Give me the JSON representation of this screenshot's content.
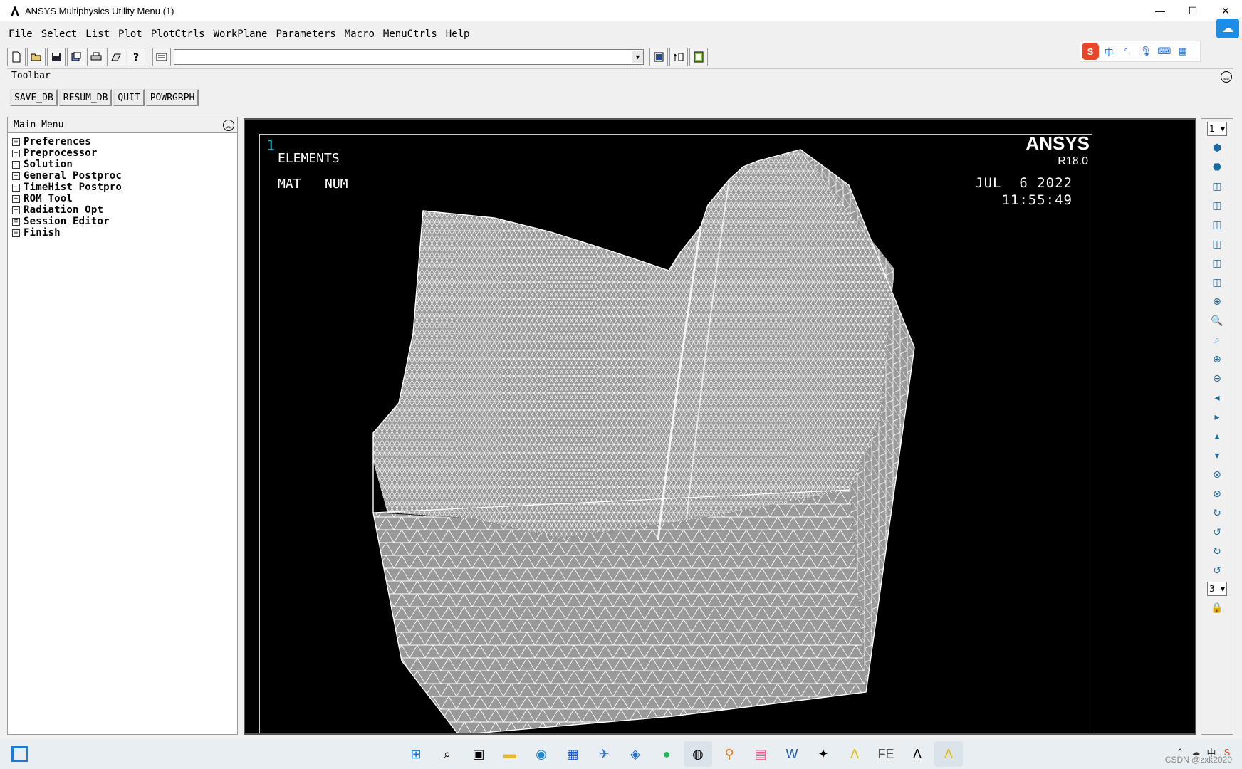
{
  "window": {
    "title": "ANSYS Multiphysics Utility Menu (1)",
    "controls": {
      "minimize": "—",
      "maximize": "☐",
      "close": "✕"
    }
  },
  "menubar": [
    "File",
    "Select",
    "List",
    "Plot",
    "PlotCtrls",
    "WorkPlane",
    "Parameters",
    "Macro",
    "MenuCtrls",
    "Help"
  ],
  "toolbar_icons": [
    "new-file-icon",
    "open-folder-icon",
    "save-icon",
    "report-icon",
    "print-icon",
    "image-icon",
    "help-icon"
  ],
  "command_input": {
    "value": "",
    "placeholder": ""
  },
  "toolbar_panel": {
    "title": "Toolbar",
    "buttons": [
      "SAVE_DB",
      "RESUM_DB",
      "QUIT",
      "POWRGRPH"
    ]
  },
  "main_menu": {
    "title": "Main Menu",
    "items": [
      {
        "label": "Preferences",
        "icon": "page-icon"
      },
      {
        "label": "Preprocessor",
        "icon": "expand-icon"
      },
      {
        "label": "Solution",
        "icon": "expand-icon"
      },
      {
        "label": "General Postproc",
        "icon": "expand-icon"
      },
      {
        "label": "TimeHist Postpro",
        "icon": "expand-icon"
      },
      {
        "label": "ROM Tool",
        "icon": "expand-icon"
      },
      {
        "label": "Radiation Opt",
        "icon": "expand-icon"
      },
      {
        "label": "Session Editor",
        "icon": "page-icon"
      },
      {
        "label": "Finish",
        "icon": "page-icon"
      }
    ]
  },
  "graphics": {
    "window_number": "1",
    "plot_label": "ELEMENTS",
    "mat_label": "MAT",
    "num_label": "NUM",
    "brand": "ANSYS",
    "version": "R18.0",
    "date": "JUL  6 2022",
    "time": "11:55:49",
    "mesh_color": "#9a9a9a",
    "line_color": "#ffffff",
    "background": "#000000"
  },
  "right_toolbar": {
    "window_select": "1",
    "rotation_increment": "3"
  },
  "taskbar": {
    "watermark": "CSDN @zxk2020"
  }
}
